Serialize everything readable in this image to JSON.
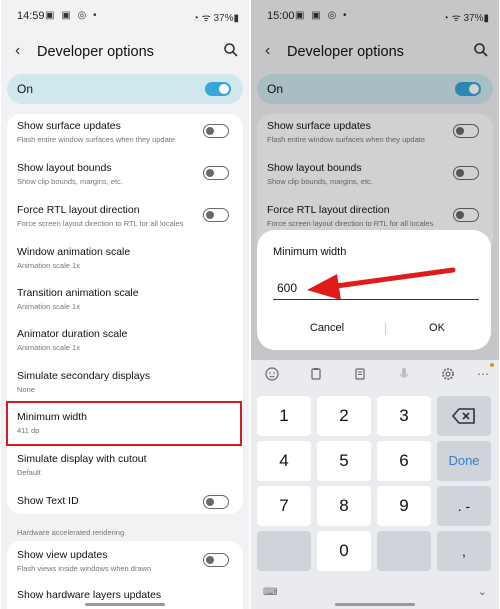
{
  "left": {
    "status": {
      "time": "14:59",
      "icons": "▣ ▣ ◎ •",
      "battery": "◔ ᯤ 37%▮"
    },
    "header": {
      "title": "Developer options"
    },
    "master_switch": {
      "label": "On",
      "state": "on"
    },
    "items": [
      {
        "title": "Show surface updates",
        "subtitle": "Flash entire window surfaces when they update",
        "toggle": "off"
      },
      {
        "title": "Show layout bounds",
        "subtitle": "Show clip bounds, margins, etc.",
        "toggle": "off"
      },
      {
        "title": "Force RTL layout direction",
        "subtitle": "Force screen layout direction to RTL for all locales",
        "toggle": "off"
      },
      {
        "title": "Window animation scale",
        "subtitle": "Animation scale 1x"
      },
      {
        "title": "Transition animation scale",
        "subtitle": "Animation scale 1x"
      },
      {
        "title": "Animator duration scale",
        "subtitle": "Animation scale 1x"
      },
      {
        "title": "Simulate secondary displays",
        "subtitle": "None"
      },
      {
        "title": "Minimum width",
        "subtitle": "411 dp"
      },
      {
        "title": "Simulate display with cutout",
        "subtitle": "Default"
      },
      {
        "title": "Show Text ID",
        "subtitle": "",
        "toggle": "off"
      }
    ],
    "section_label": "Hardware accelerated rendering",
    "items2": [
      {
        "title": "Show view updates",
        "subtitle": "Flash views inside windows when drawn",
        "toggle": "off"
      },
      {
        "title": "Show hardware layers updates",
        "subtitle": ""
      }
    ]
  },
  "right": {
    "status": {
      "time": "15:00",
      "icons": "▣ ▣ ◎ •",
      "battery": "◔ ᯤ 37%▮"
    },
    "header": {
      "title": "Developer options"
    },
    "master_switch": {
      "label": "On",
      "state": "on"
    },
    "items": [
      {
        "title": "Show surface updates",
        "subtitle": "Flash entire window surfaces when they update",
        "toggle": "off"
      },
      {
        "title": "Show layout bounds",
        "subtitle": "Show clip bounds, margins, etc.",
        "toggle": "off"
      },
      {
        "title": "Force RTL layout direction",
        "subtitle": "Force screen layout direction to RTL for all locales",
        "toggle": "off"
      }
    ],
    "dialog": {
      "title": "Minimum width",
      "value": "600",
      "cancel": "Cancel",
      "ok": "OK"
    },
    "keyboard": {
      "keys": [
        "1",
        "2",
        "3",
        "4",
        "5",
        "6",
        "7",
        "8",
        "9",
        "0"
      ],
      "done": "Done",
      "punct": ". -",
      "comma": ","
    }
  },
  "colors": {
    "accent": "#37a6d8",
    "highlight": "#d21e1e",
    "arrow": "#e01b1b",
    "on_card": "#cfe8ee"
  },
  "icons": [
    "back-arrow-icon",
    "search-icon",
    "backspace-icon",
    "emoji-icon",
    "clipboard-icon",
    "text-icon",
    "mic-icon",
    "gear-icon",
    "more-icon",
    "chevron-down-icon",
    "keyboard-icon"
  ]
}
